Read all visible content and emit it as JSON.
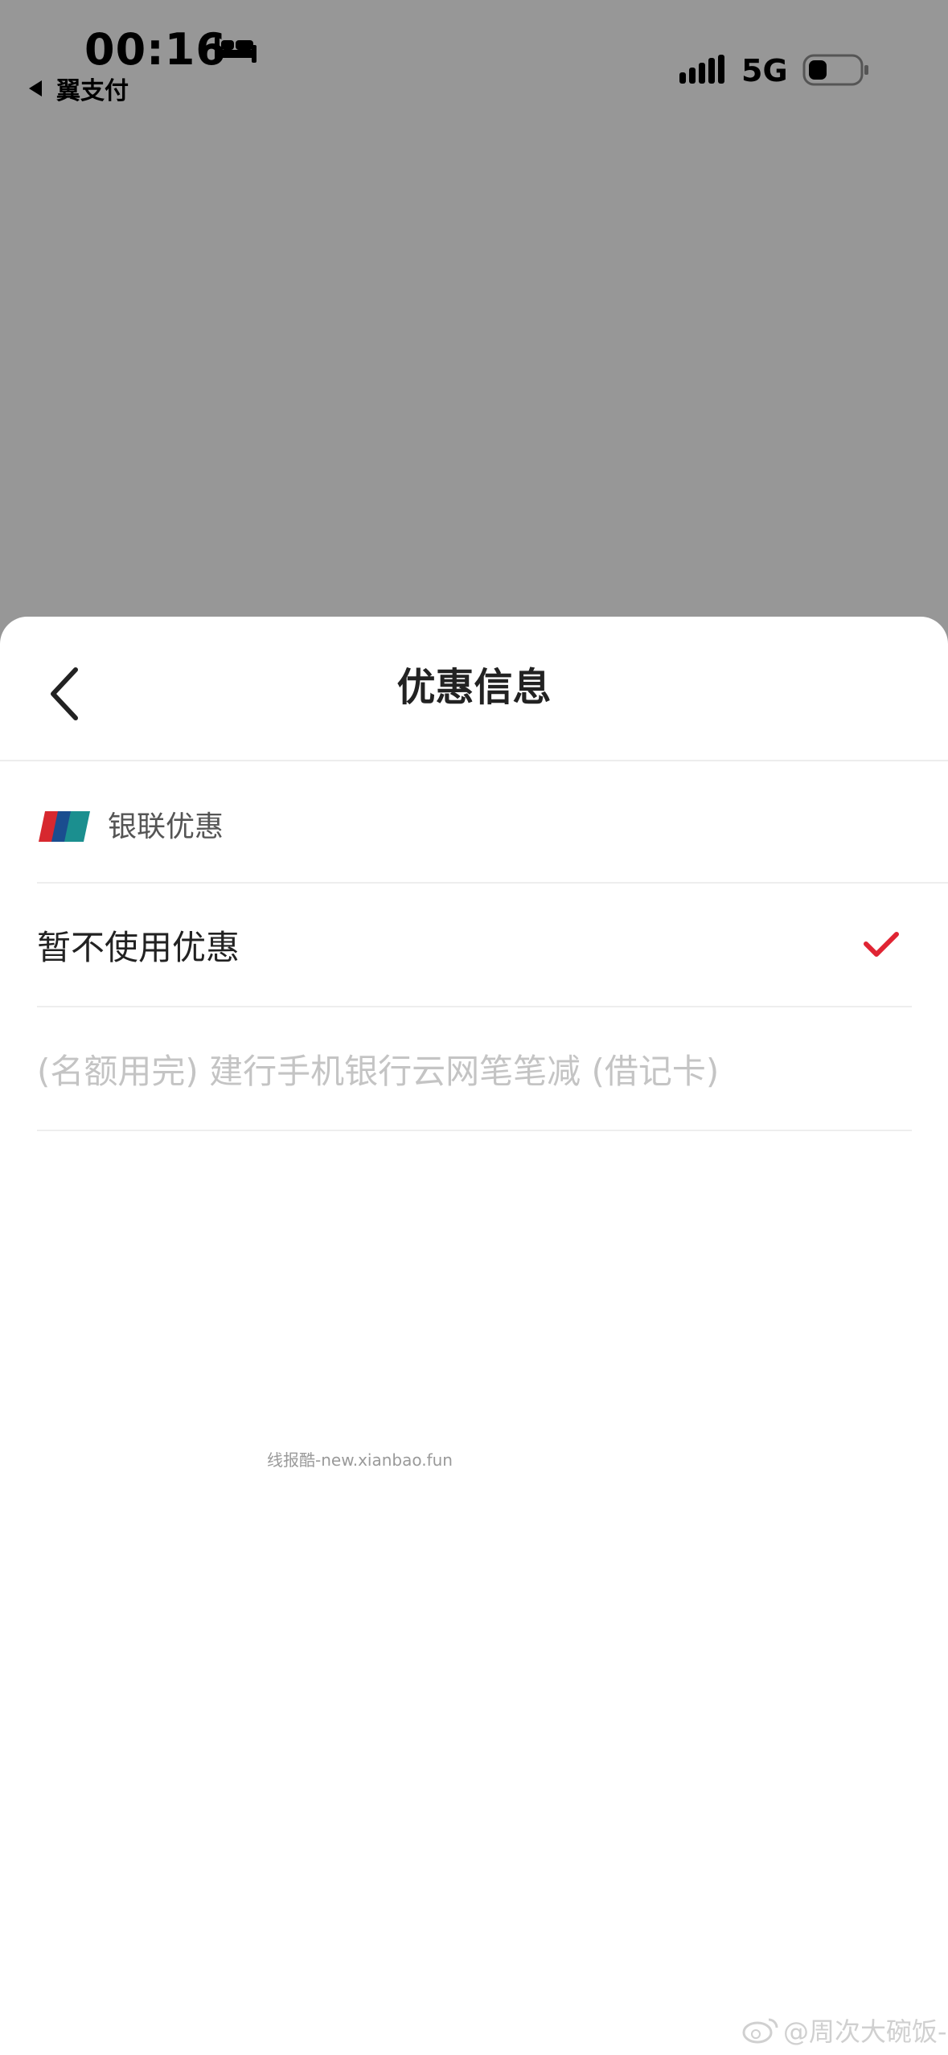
{
  "status_bar": {
    "time": "00:16",
    "back_app_label": "翼支付",
    "network": "5G"
  },
  "sheet": {
    "title": "优惠信息",
    "group_label": "银联优惠",
    "options": [
      {
        "label": "暂不使用优惠",
        "selected": true,
        "disabled": false
      },
      {
        "label": "(名额用完) 建行手机银行云网笔笔减 (借记卡)",
        "selected": false,
        "disabled": true
      }
    ]
  },
  "watermark": "线报酷-new.xianbao.fun",
  "weibo_watermark": "@周次大碗饭-",
  "colors": {
    "accent_check": "#e02433",
    "dim_overlay": "#979797"
  }
}
